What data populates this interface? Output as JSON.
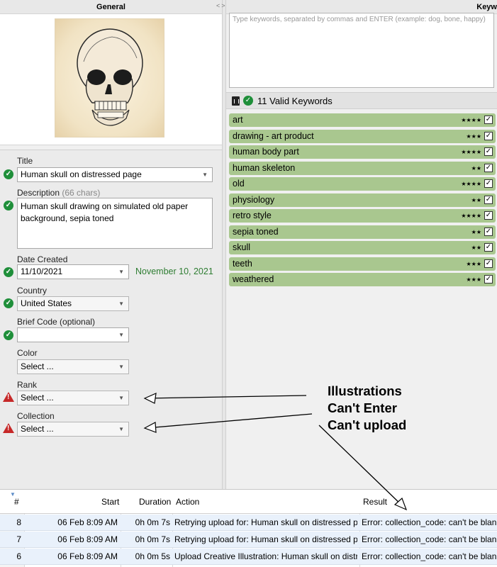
{
  "panes": {
    "left_title": "General",
    "right_title": "Keyw",
    "splitter_arrows": "<>"
  },
  "form": {
    "title_label": "Title",
    "title_value": "Human skull on distressed page",
    "description_label": "Description",
    "description_count": "(66 chars)",
    "description_value": "Human skull drawing on simulated old paper background, sepia toned",
    "date_label": "Date Created",
    "date_value": "11/10/2021",
    "date_long": "November 10, 2021",
    "country_label": "Country",
    "country_value": "United States",
    "brief_label": "Brief Code (optional)",
    "brief_value": "",
    "color_label": "Color",
    "color_value": "Select ...",
    "rank_label": "Rank",
    "rank_value": "Select ...",
    "collection_label": "Collection",
    "collection_value": "Select ..."
  },
  "keywords": {
    "placeholder": "Type keywords, separated by commas and ENTER (example: dog, bone, happy)",
    "valid_count_label": "11 Valid Keywords",
    "items": [
      {
        "label": "art",
        "stars": "★★★★"
      },
      {
        "label": "drawing - art product",
        "stars": "★★★"
      },
      {
        "label": "human body part",
        "stars": "★★★★"
      },
      {
        "label": "human skeleton",
        "stars": "★★"
      },
      {
        "label": "old",
        "stars": "★★★★"
      },
      {
        "label": "physiology",
        "stars": "★★"
      },
      {
        "label": "retro style",
        "stars": "★★★★"
      },
      {
        "label": "sepia toned",
        "stars": "★★"
      },
      {
        "label": "skull",
        "stars": "★★"
      },
      {
        "label": "teeth",
        "stars": "★★★"
      },
      {
        "label": "weathered",
        "stars": "★★★"
      }
    ]
  },
  "log": {
    "headers": {
      "num": "#",
      "start": "Start",
      "duration": "Duration",
      "action": "Action",
      "result": "Result"
    },
    "rows": [
      {
        "num": "8",
        "start": "06 Feb 8:09 AM",
        "duration": "0h 0m 7s",
        "action": "Retrying upload for: Human skull on distressed page (",
        "result": "Error: collection_code: can't be blank"
      },
      {
        "num": "7",
        "start": "06 Feb 8:09 AM",
        "duration": "0h 0m 7s",
        "action": "Retrying upload for: Human skull on distressed page (",
        "result": "Error: collection_code: can't be blank"
      },
      {
        "num": "6",
        "start": "06 Feb 8:09 AM",
        "duration": "0h 0m 5s",
        "action": "Upload Creative Illustration: Human skull on distresse",
        "result": "Error: collection_code: can't be blank"
      }
    ]
  },
  "annotation": {
    "line1": "Illustrations",
    "line2": "Can't Enter",
    "line3": "Can't upload"
  },
  "colors": {
    "keyword_bg": "#a9c78f",
    "ok_green": "#1f8f3a",
    "warn_red": "#c62828",
    "row_bg": "#e9f1fb"
  }
}
